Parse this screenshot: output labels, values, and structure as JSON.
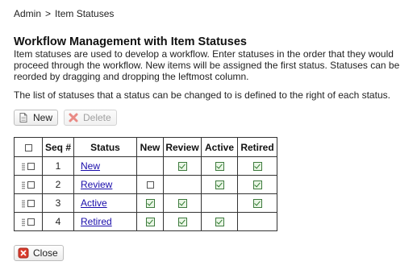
{
  "breadcrumb": {
    "root": "Admin",
    "separator": ">",
    "current": "Item Statuses"
  },
  "title": "Workflow Management with Item Statuses",
  "description": "Item statuses are used to develop a workflow. Enter statuses in the order that they would proceed through the workflow. New items will be assigned the first status. Statuses can be reorded by dragging and dropping the leftmost column.",
  "description2": "The list of statuses that a status can be changed to is defined to the right of each status.",
  "toolbar": {
    "new_label": "New",
    "delete_label": "Delete"
  },
  "table": {
    "headers": {
      "seq": "Seq #",
      "status": "Status",
      "new": "New",
      "review": "Review",
      "active": "Active",
      "retired": "Retired"
    },
    "rows": [
      {
        "seq": "1",
        "status": "New",
        "transitions": {
          "new": null,
          "review": true,
          "active": true,
          "retired": true
        }
      },
      {
        "seq": "2",
        "status": "Review",
        "transitions": {
          "new": false,
          "review": null,
          "active": true,
          "retired": true
        }
      },
      {
        "seq": "3",
        "status": "Active",
        "transitions": {
          "new": true,
          "review": true,
          "active": null,
          "retired": true
        }
      },
      {
        "seq": "4",
        "status": "Retired",
        "transitions": {
          "new": true,
          "review": true,
          "active": true,
          "retired": null
        }
      }
    ]
  },
  "footer": {
    "close_label": "Close"
  },
  "colors": {
    "link": "#1a0dab",
    "check_green": "#2e7a2e",
    "delete_red": "#d9534f",
    "close_red": "#d93a2b"
  }
}
